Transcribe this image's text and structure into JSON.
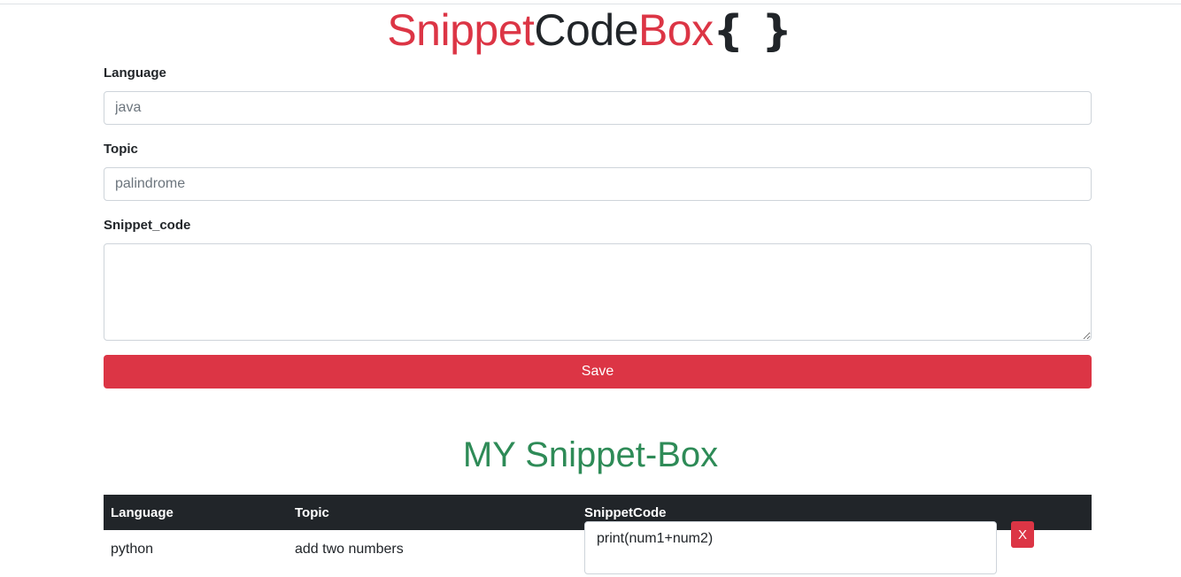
{
  "brand": {
    "part1": "Snippet",
    "part2": "Code",
    "part3": "Box",
    "braces": "{ }"
  },
  "form": {
    "language_label": "Language",
    "language_placeholder": "java",
    "topic_label": "Topic",
    "topic_placeholder": "palindrome",
    "snippet_label": "Snippet_code",
    "snippet_value": "",
    "save_label": "Save"
  },
  "snippets": {
    "title": "MY Snippet-Box",
    "columns": [
      "Language",
      "Topic",
      "SnippetCode"
    ],
    "rows": [
      {
        "language": "python",
        "topic": "add two numbers",
        "code": "print(num1+num2)",
        "delete_label": "X"
      }
    ]
  },
  "colors": {
    "accent_red": "#dc3545",
    "header_dark": "#212529",
    "title_green": "#2e8b57"
  }
}
